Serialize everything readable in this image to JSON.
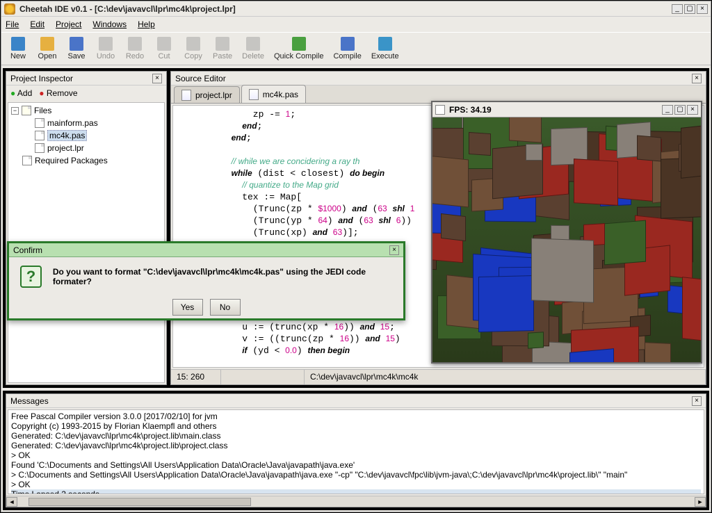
{
  "window": {
    "title": "Cheetah IDE v0.1 - [C:\\dev\\javavcl\\lpr\\mc4k\\project.lpr]"
  },
  "menu": [
    "File",
    "Edit",
    "Project",
    "Windows",
    "Help"
  ],
  "toolbar": [
    {
      "label": "New",
      "c": "#3a84c8"
    },
    {
      "label": "Open",
      "c": "#e6b040"
    },
    {
      "label": "Save",
      "c": "#4a74c8"
    },
    {
      "label": "Undo",
      "c": "#999",
      "d": true
    },
    {
      "label": "Redo",
      "c": "#999",
      "d": true
    },
    {
      "label": "Cut",
      "c": "#999",
      "d": true
    },
    {
      "label": "Copy",
      "c": "#999",
      "d": true
    },
    {
      "label": "Paste",
      "c": "#999",
      "d": true
    },
    {
      "label": "Delete",
      "c": "#999",
      "d": true
    },
    {
      "label": "Quick Compile",
      "c": "#4aa040"
    },
    {
      "label": "Compile",
      "c": "#4a74c8"
    },
    {
      "label": "Execute",
      "c": "#3a94c8"
    }
  ],
  "inspector": {
    "title": "Project Inspector",
    "add": "Add",
    "remove": "Remove",
    "files_label": "Files",
    "files": [
      "mainform.pas",
      "mc4k.pas",
      "project.lpr"
    ],
    "selected": "mc4k.pas",
    "req": "Required Packages"
  },
  "editor": {
    "title": "Source Editor",
    "tabs": [
      "project.lpr",
      "mc4k.pas"
    ],
    "active_tab": 1,
    "status_pos": "15: 260",
    "status_path": "C:\\dev\\javavcl\\lpr\\mc4k\\mc4k"
  },
  "game": {
    "title": "FPS: 34.19"
  },
  "dialog": {
    "title": "Confirm",
    "msg": "Do you want to format \"C:\\dev\\javavcl\\lpr\\mc4k\\mc4k.pas\" using the JEDI code formater?",
    "yes": "Yes",
    "no": "No"
  },
  "messages": {
    "title": "Messages",
    "lines": [
      "Free Pascal Compiler version 3.0.0 [2017/02/10] for jvm",
      "Copyright (c) 1993-2015 by Florian Klaempfl and others",
      "Generated: C:\\dev\\javavcl\\lpr\\mc4k\\project.lib\\main.class",
      "Generated: C:\\dev\\javavcl\\lpr\\mc4k\\project.lib\\project.class",
      "> OK",
      "Found 'C:\\Documents and Settings\\All Users\\Application Data\\Oracle\\Java\\javapath\\java.exe'",
      "> C:\\Documents and Settings\\All Users\\Application Data\\Oracle\\Java\\javapath\\java.exe \"-cp\" \"C:\\dev\\javavcl\\fpc\\lib\\jvm-java\\;C:\\dev\\javavcl\\lpr\\mc4k\\project.lib\\\" \"main\"",
      "> OK",
      "Time Lapsed 2 seconds"
    ],
    "selected_line": 8
  }
}
